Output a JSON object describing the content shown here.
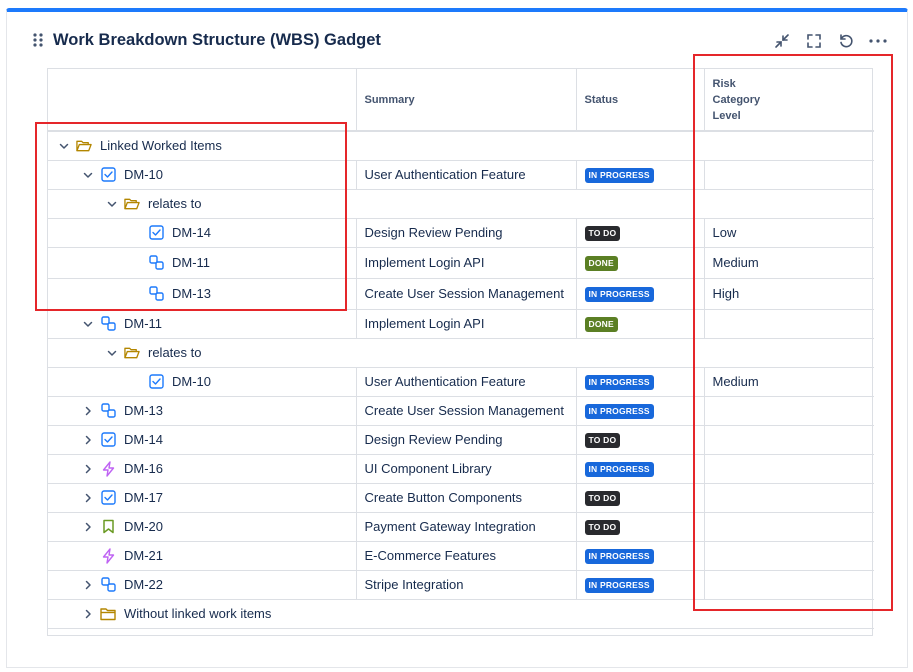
{
  "gadget": {
    "title": "Work Breakdown Structure (WBS) Gadget",
    "accent_color": "#1d7afc"
  },
  "table": {
    "headers": {
      "tree": "",
      "summary": "Summary",
      "status": "Status",
      "risk_line1": "Risk",
      "risk_line2": "Category",
      "risk_line3": "Level"
    },
    "rows": [
      {
        "type": "group",
        "indent": 0,
        "chevron": "down",
        "icon": "folder-open-icon",
        "label": "Linked Worked Items"
      },
      {
        "type": "item",
        "indent": 1,
        "chevron": "down",
        "icon": "task-checkbox-icon",
        "key": "DM-10",
        "summary": "User Authentication Feature",
        "status": "IN PROGRESS",
        "status_kind": "inprogress",
        "risk": ""
      },
      {
        "type": "group",
        "indent": 2,
        "chevron": "down",
        "icon": "folder-open-icon",
        "label": "relates to"
      },
      {
        "type": "item",
        "indent": 3,
        "chevron": "none",
        "icon": "task-checkbox-icon",
        "key": "DM-14",
        "summary": "Design Review Pending",
        "status": "TO DO",
        "status_kind": "todo",
        "risk": "Low"
      },
      {
        "type": "item",
        "indent": 3,
        "chevron": "none",
        "icon": "subtask-icon",
        "key": "DM-11",
        "summary": "Implement Login API",
        "status": "DONE",
        "status_kind": "done",
        "risk": "Medium"
      },
      {
        "type": "item",
        "indent": 3,
        "chevron": "none",
        "icon": "subtask-icon",
        "key": "DM-13",
        "summary": "Create User Session Management",
        "status": "IN PROGRESS",
        "status_kind": "inprogress",
        "risk": "High"
      },
      {
        "type": "item",
        "indent": 1,
        "chevron": "down",
        "icon": "subtask-icon",
        "key": "DM-11",
        "summary": "Implement Login API",
        "status": "DONE",
        "status_kind": "done",
        "risk": ""
      },
      {
        "type": "group",
        "indent": 2,
        "chevron": "down",
        "icon": "folder-open-icon",
        "label": "relates to"
      },
      {
        "type": "item",
        "indent": 3,
        "chevron": "none",
        "icon": "task-checkbox-icon",
        "key": "DM-10",
        "summary": "User Authentication Feature",
        "status": "IN PROGRESS",
        "status_kind": "inprogress",
        "risk": "Medium"
      },
      {
        "type": "item",
        "indent": 1,
        "chevron": "right",
        "icon": "subtask-icon",
        "key": "DM-13",
        "summary": "Create User Session Management",
        "status": "IN PROGRESS",
        "status_kind": "inprogress",
        "risk": ""
      },
      {
        "type": "item",
        "indent": 1,
        "chevron": "right",
        "icon": "task-checkbox-icon",
        "key": "DM-14",
        "summary": "Design Review Pending",
        "status": "TO DO",
        "status_kind": "todo",
        "risk": ""
      },
      {
        "type": "item",
        "indent": 1,
        "chevron": "right",
        "icon": "epic-lightning-icon",
        "key": "DM-16",
        "summary": "UI Component Library",
        "status": "IN PROGRESS",
        "status_kind": "inprogress",
        "risk": ""
      },
      {
        "type": "item",
        "indent": 1,
        "chevron": "right",
        "icon": "task-checkbox-icon",
        "key": "DM-17",
        "summary": "Create Button Components",
        "status": "TO DO",
        "status_kind": "todo",
        "risk": ""
      },
      {
        "type": "item",
        "indent": 1,
        "chevron": "right",
        "icon": "story-bookmark-icon",
        "key": "DM-20",
        "summary": "Payment Gateway Integration",
        "status": "TO DO",
        "status_kind": "todo",
        "risk": ""
      },
      {
        "type": "item",
        "indent": 1,
        "chevron": "none",
        "icon": "epic-lightning-icon",
        "key": "DM-21",
        "summary": "E-Commerce Features",
        "status": "IN PROGRESS",
        "status_kind": "inprogress",
        "risk": ""
      },
      {
        "type": "item",
        "indent": 1,
        "chevron": "right",
        "icon": "subtask-icon",
        "key": "DM-22",
        "summary": "Stripe Integration",
        "status": "IN PROGRESS",
        "status_kind": "inprogress",
        "risk": ""
      },
      {
        "type": "group",
        "indent": 1,
        "chevron": "right",
        "icon": "folder-closed-icon",
        "label": "Without linked work items"
      }
    ]
  },
  "colors": {
    "in_progress": "#1868db",
    "to_do": "#292a2e",
    "done": "#5b7f24",
    "highlight_box": "#e5262a",
    "folder": "#b38600",
    "task": "#1d7afc",
    "epic": "#bf63f3",
    "story": "#6a9a23"
  }
}
